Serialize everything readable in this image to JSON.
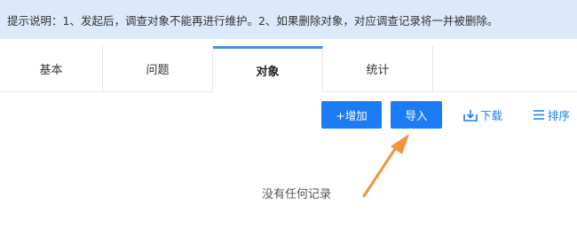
{
  "notice": {
    "text": "提示说明：1、发起后，调查对象不能再进行维护。2、如果删除对象，对应调查记录将一并被删除。"
  },
  "tabs": [
    {
      "label": "基本"
    },
    {
      "label": "问题"
    },
    {
      "label": "对象",
      "active": true
    },
    {
      "label": "统计"
    }
  ],
  "toolbar": {
    "add_label": "+增加",
    "import_label": "导入",
    "download_label": "下载",
    "sort_label": "排序"
  },
  "empty_text": "没有任何记录",
  "colors": {
    "notice_bg": "#dbe9fb",
    "primary": "#1b7cf5",
    "active_tab_indicator": "#4a90e2",
    "arrow": "#f5923e"
  }
}
